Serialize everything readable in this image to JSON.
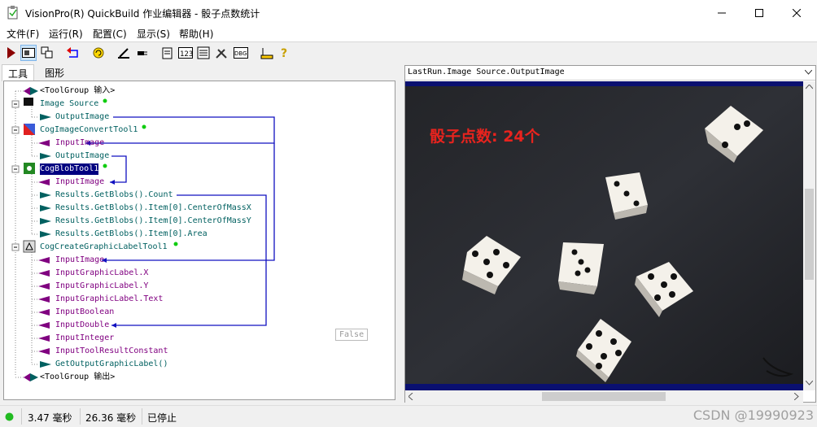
{
  "window": {
    "title": "VisionPro(R) QuickBuild 作业编辑器 - 骰子点数统计"
  },
  "menu": [
    "文件(F)",
    "运行(R)",
    "配置(C)",
    "显示(S)",
    "帮助(H)"
  ],
  "tabs": [
    "工具",
    "图形"
  ],
  "tree": {
    "items": [
      "<ToolGroup 输入>",
      "Image Source",
      "OutputImage",
      "CogImageConvertTool1",
      "InputImage",
      "OutputImage",
      "CogBlobTool1",
      "InputImage",
      "Results.GetBlobs().Count",
      "Results.GetBlobs().Item[0].CenterOfMassX",
      "Results.GetBlobs().Item[0].CenterOfMassY",
      "Results.GetBlobs().Item[0].Area",
      "CogCreateGraphicLabelTool1",
      "InputImage",
      "InputGraphicLabel.X",
      "InputGraphicLabel.Y",
      "InputGraphicLabel.Text",
      "InputBoolean",
      "InputDouble",
      "InputInteger",
      "InputToolResultConstant",
      "GetOutputGraphicLabel()",
      "<ToolGroup 输出>"
    ],
    "tooltip": "False"
  },
  "image_panel": {
    "title": "LastRun.Image Source.OutputImage",
    "overlay_text": "骰子点数: 24个",
    "overlay_color": "#e8231e"
  },
  "status": {
    "time1": "3.47 毫秒",
    "time2": "26.36 毫秒",
    "state": "已停止",
    "indicator_color": "#22bb22"
  },
  "watermark": "CSDN @19990923"
}
